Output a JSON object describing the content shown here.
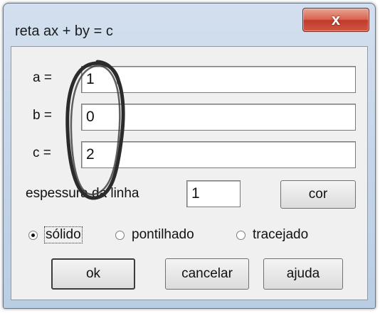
{
  "window": {
    "title": "reta ax + by = c",
    "close_glyph": "x"
  },
  "fields": {
    "a": {
      "label": "a =",
      "value": "1"
    },
    "b": {
      "label": "b =",
      "value": "0"
    },
    "c": {
      "label": "c =",
      "value": "2"
    }
  },
  "thickness": {
    "label": "espessura da linha",
    "value": "1"
  },
  "color_button": {
    "label": "cor"
  },
  "line_style": {
    "options": [
      {
        "label": "sólido",
        "checked": true
      },
      {
        "label": "pontilhado",
        "checked": false
      },
      {
        "label": "tracejado",
        "checked": false
      }
    ]
  },
  "buttons": {
    "ok": "ok",
    "cancel": "cancelar",
    "help": "ajuda"
  }
}
